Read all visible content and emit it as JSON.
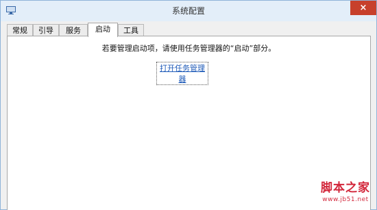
{
  "window": {
    "title": "系统配置",
    "close_label": "×",
    "app_icon": "system-config-icon"
  },
  "tabs": [
    {
      "label": "常规"
    },
    {
      "label": "引导"
    },
    {
      "label": "服务"
    },
    {
      "label": "启动",
      "selected": true
    },
    {
      "label": "工具"
    }
  ],
  "startup": {
    "message": "若要管理启动项，请使用任务管理器的“启动”部分。",
    "link_label": "打开任务管理器"
  },
  "watermark": {
    "text": "脚本之家",
    "url": "www.jb51.net"
  },
  "colors": {
    "close": "#c7402c",
    "link": "#1e5ab8",
    "watermark": "#d2263a"
  }
}
